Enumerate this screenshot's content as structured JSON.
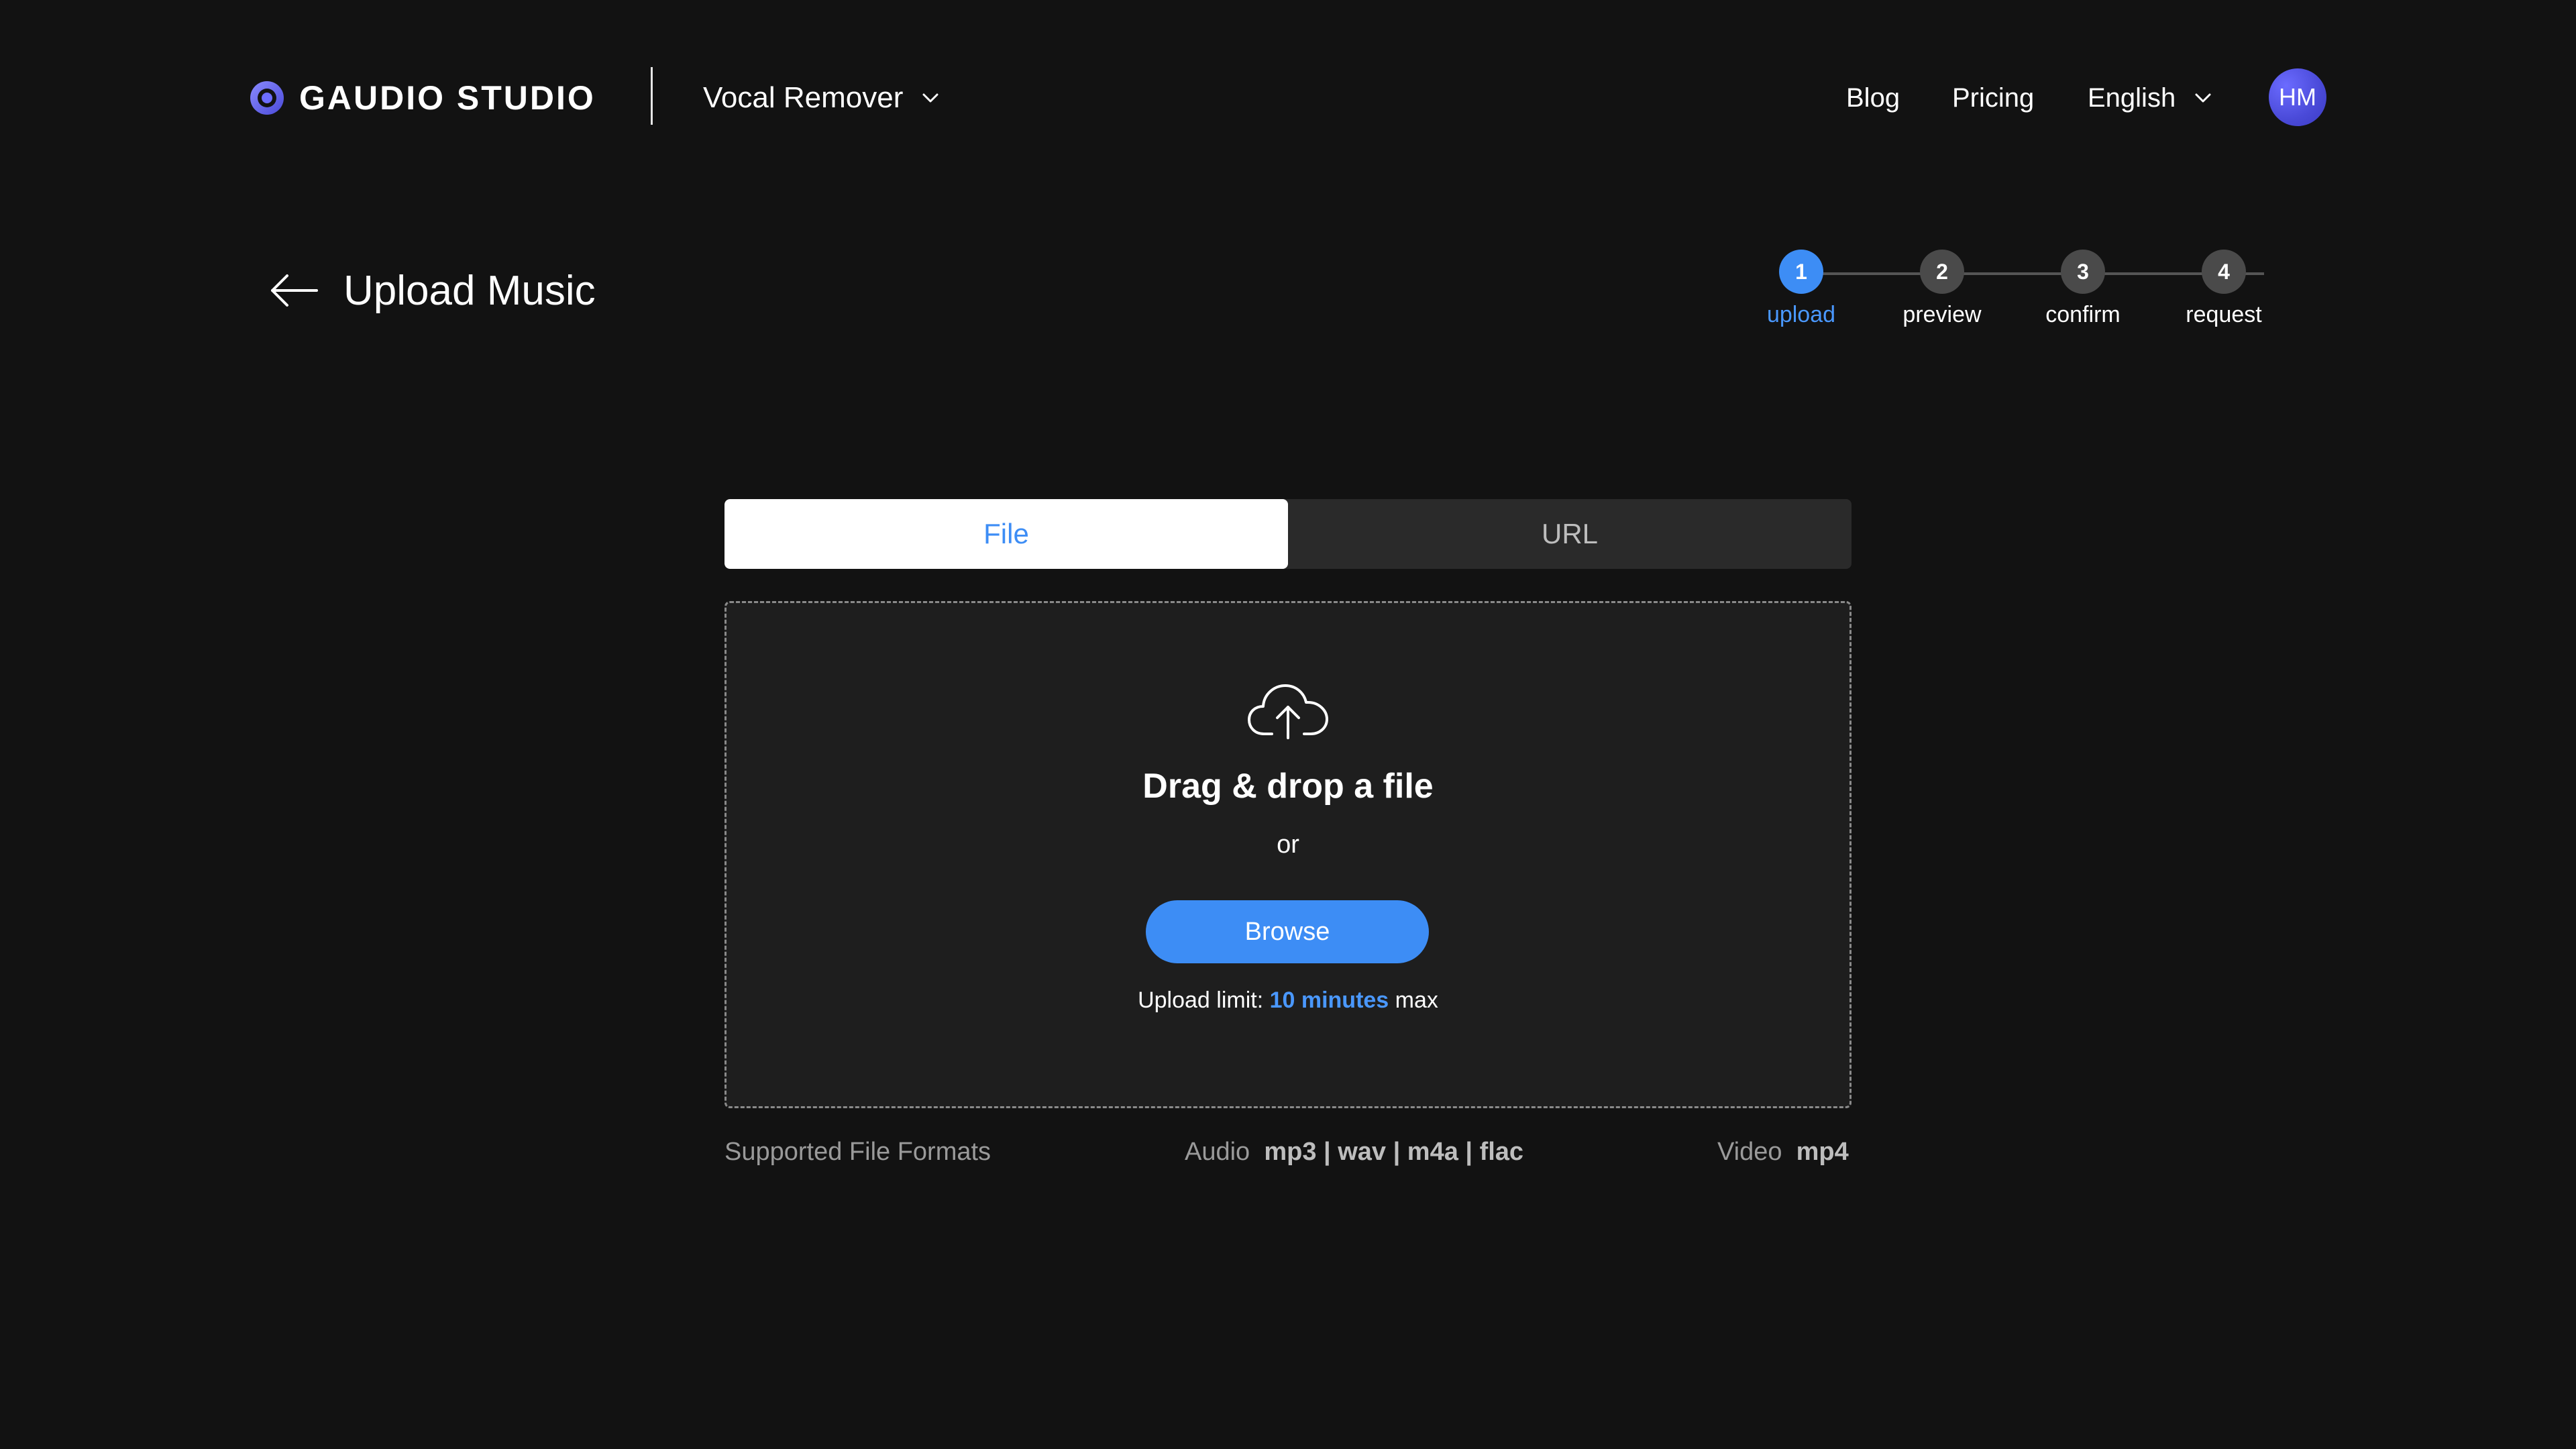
{
  "header": {
    "brand": "GAUDIO STUDIO",
    "product": "Vocal Remover",
    "nav": {
      "blog": "Blog",
      "pricing": "Pricing",
      "language": "English"
    },
    "avatar_initials": "HM"
  },
  "page": {
    "title": "Upload Music"
  },
  "stepper": {
    "steps": [
      {
        "number": "1",
        "label": "upload",
        "active": true
      },
      {
        "number": "2",
        "label": "preview",
        "active": false
      },
      {
        "number": "3",
        "label": "confirm",
        "active": false
      },
      {
        "number": "4",
        "label": "request",
        "active": false
      }
    ]
  },
  "tabs": {
    "file": "File",
    "url": "URL",
    "selected": "File"
  },
  "dropzone": {
    "title": "Drag & drop a file",
    "or": "or",
    "browse": "Browse",
    "limit_prefix": "Upload limit: ",
    "limit_value": "10 minutes",
    "limit_suffix": " max"
  },
  "formats": {
    "label": "Supported File Formats",
    "audio_label": "Audio",
    "audio_types": "mp3 | wav | m4a | flac",
    "video_label": "Video",
    "video_types": "mp4"
  },
  "colors": {
    "background": "#121212",
    "accent": "#3d8df5",
    "panel": "#1e1e1e"
  }
}
